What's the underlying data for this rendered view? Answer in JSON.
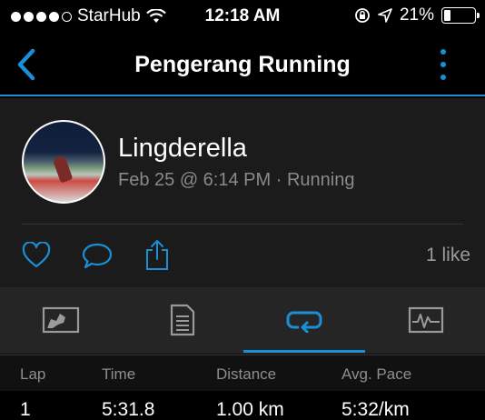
{
  "status_bar": {
    "carrier": "StarHub",
    "time": "12:18 AM",
    "battery_percent": "21%",
    "battery_level": 0.21,
    "signal_dots_filled": 4,
    "signal_dots_total": 5,
    "icons": [
      "wifi-icon",
      "rotation-lock-icon",
      "location-icon",
      "battery-icon"
    ]
  },
  "nav": {
    "title": "Pengerang Running",
    "back_icon": "chevron-left-icon",
    "more_icon": "vertical-dots-icon",
    "accent_color": "#1a8fd6"
  },
  "activity": {
    "user_name": "Lingderella",
    "meta": "Feb 25 @ 6:14 PM · Running"
  },
  "actions": {
    "icons": [
      "heart-icon",
      "comment-icon",
      "share-icon"
    ],
    "like_count": "1 like"
  },
  "tabs": {
    "items": [
      "map-tab",
      "details-tab",
      "laps-tab",
      "charts-tab"
    ],
    "active": "laps-tab"
  },
  "laps_table": {
    "headers": [
      "Lap",
      "Time",
      "Distance",
      "Avg. Pace"
    ],
    "rows": [
      [
        "1",
        "5:31.8",
        "1.00 km",
        "5:32/km"
      ]
    ]
  }
}
